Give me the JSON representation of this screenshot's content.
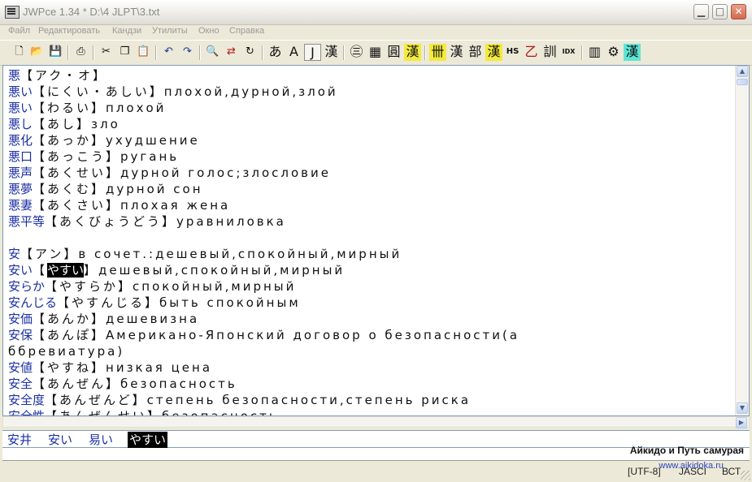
{
  "window": {
    "title": "JWPce 1.34 * D:\\4 JLPT\\3.txt",
    "minimize": "▁",
    "maximize": "□",
    "close": "✕"
  },
  "menu": [
    "Файл",
    "Редактировать",
    "Кандзи",
    "Утилиты",
    "Окно",
    "Справка"
  ],
  "toolbar": {
    "mode_buttons": [
      "あ",
      "A",
      "J",
      "漢"
    ],
    "right_labels": [
      "HS",
      "IDX"
    ]
  },
  "editor_lines": [
    {
      "k": "悪",
      "r": "【アク・オ】"
    },
    {
      "k": "悪い",
      "r": "【にくい・あしい】плохой,дурной,злой"
    },
    {
      "k": "悪い",
      "r": "【わるい】плохой"
    },
    {
      "k": "悪し",
      "r": "【あし】зло"
    },
    {
      "k": "悪化",
      "r": "【あっか】ухудшение"
    },
    {
      "k": "悪口",
      "r": "【あっこう】ругань"
    },
    {
      "k": "悪声",
      "r": "【あくせい】дурной голос;злословие"
    },
    {
      "k": "悪夢",
      "r": "【あくむ】дурной сон"
    },
    {
      "k": "悪妻",
      "r": "【あくさい】плохая жена"
    },
    {
      "k": "悪平等",
      "r": "【あくびょうどう】уравниловка"
    },
    {
      "k": "",
      "r": ""
    },
    {
      "k": "安",
      "r": "【アン】в сочет.:дешевый,спокойный,мирный"
    },
    {
      "k": "安い",
      "r": "【",
      "hl": "やすい",
      "r2": "】дешевый,спокойный,мирный"
    },
    {
      "k": "安らか",
      "r": "【やすらか】спокойный,мирный"
    },
    {
      "k": "安んじる",
      "r": "【やすんじる】быть спокойным"
    },
    {
      "k": "安価",
      "r": "【あんか】дешевизна"
    },
    {
      "k": "安保",
      "r": "【あんぽ】Американо-Японский договор о безопасности(а"
    },
    {
      "k": "",
      "r": "ббревиатура)"
    },
    {
      "k": "安値",
      "r": "【やすね】низкая цена"
    },
    {
      "k": "安全",
      "r": "【あんぜん】безопасность"
    },
    {
      "k": "安全度",
      "r": "【あんぜんど】степень безопасности,степень риска"
    },
    {
      "k": "安全性",
      "r": "【あんぜんせい】безопасность"
    }
  ],
  "candidates": [
    "安井",
    "安い",
    "易い",
    "やすい"
  ],
  "watermark": {
    "line1": "Айкидо и Путь самурая",
    "line2": "www.aikidoka.ru"
  },
  "status": {
    "encoding": "[UTF-8]",
    "charset": "JASCI",
    "mode": "ВСТ"
  }
}
